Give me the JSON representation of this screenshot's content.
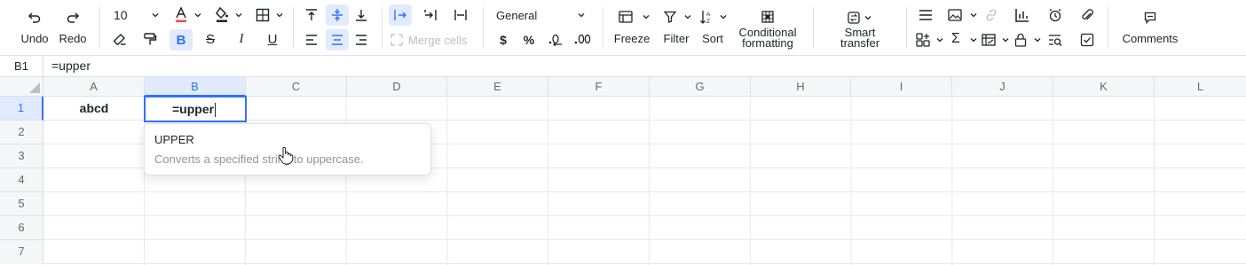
{
  "toolbar": {
    "undo_label": "Undo",
    "redo_label": "Redo",
    "font_size": "10",
    "merge_cells_label": "Merge cells",
    "number_format": "General",
    "currency_symbol": "$",
    "percent_symbol": "%",
    "freeze_label": "Freeze",
    "filter_label": "Filter",
    "sort_label": "Sort",
    "conditional_formatting_line1": "Conditional",
    "conditional_formatting_line2": "formatting",
    "smart_transfer_line1": "Smart",
    "smart_transfer_line2": "transfer",
    "comments_label": "Comments",
    "accent_color": "#3370ff",
    "font_color_swatch": "#f54a45"
  },
  "formula_bar": {
    "cell_reference": "B1",
    "formula": "=upper"
  },
  "grid": {
    "columns": [
      "A",
      "B",
      "C",
      "D",
      "E",
      "F",
      "G",
      "H",
      "I",
      "J",
      "K",
      "L"
    ],
    "rows": [
      "1",
      "2",
      "3",
      "4",
      "5",
      "6",
      "7"
    ],
    "selected_column": "B",
    "selected_row": "1",
    "cells": {
      "A1": "abcd",
      "B1": "=upper"
    }
  },
  "autocomplete": {
    "function_name": "UPPER",
    "description": "Converts a specified string to uppercase."
  }
}
